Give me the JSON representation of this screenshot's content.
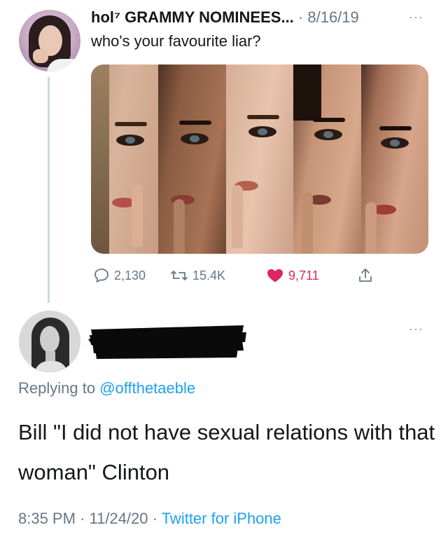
{
  "parent_tweet": {
    "author_name": "hol⁷ GRAMMY NOMINEES...",
    "date": "· 8/16/19",
    "more_icon": "···",
    "text": "who's your favourite liar?",
    "stats": {
      "replies": "2,130",
      "retweets": "15.4K",
      "likes": "9,711"
    }
  },
  "reply_tweet": {
    "more_icon": "···",
    "replying_prefix": "Replying to",
    "replying_handle": "@offthetaeble",
    "text": "Bill \"I did not have sexual relations with that woman\" Clinton",
    "time": "8:35 PM",
    "date": "11/24/20",
    "client": "Twitter for iPhone"
  },
  "colors": {
    "link": "#1da1f2",
    "muted": "#657786",
    "like": "#e0245e",
    "thread_line": "#cfd9de"
  }
}
